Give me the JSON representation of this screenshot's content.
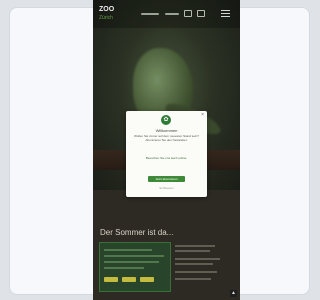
{
  "page": {
    "logo": {
      "primary": "ZOO",
      "secondary": "Zürich"
    },
    "nav": {
      "menu_icon": "hamburger-icon"
    },
    "section": {
      "title": "Der Sommer ist da..."
    },
    "modal": {
      "icon": "leaf-icon",
      "title": "Willkommen",
      "body": "Wollen Sie immer auf dem neuesten Stand sein? Abonnieren Sie den Newsletter.",
      "note": "Besuchen Sie uns auch online.",
      "button_label": "Jetzt abonnieren",
      "dismiss_label": "Schliessen",
      "close_glyph": "×"
    },
    "colors": {
      "accent": "#3f8a39",
      "dark_green": "#2c4a2f",
      "yellow_button": "#d6cb45"
    }
  }
}
